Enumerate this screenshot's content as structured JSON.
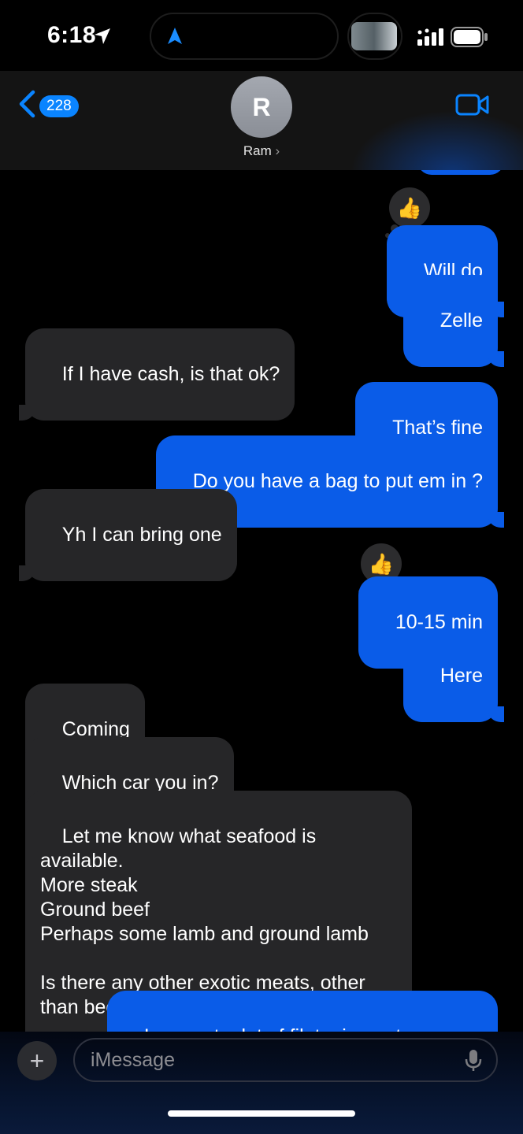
{
  "status_bar": {
    "time": "6:18",
    "icons": [
      "location-arrow-icon",
      "navigation-arrow-icon",
      "signal-icon",
      "battery-icon"
    ]
  },
  "header": {
    "back_count": "228",
    "avatar_initial": "R",
    "contact_name": "Ram",
    "contact_chevron": "›",
    "icons": [
      "chevron-left-icon",
      "video-call-icon"
    ]
  },
  "messages": [
    {
      "from": "me",
      "text": "Will do",
      "reaction": "👍"
    },
    {
      "from": "me",
      "text": "Zelle"
    },
    {
      "from": "them",
      "text": "If I have cash, is that ok?"
    },
    {
      "from": "me",
      "text": "That’s fine"
    },
    {
      "from": "me",
      "text": "Do you have a bag to put em in ?"
    },
    {
      "from": "them",
      "text": "Yh I can bring one"
    },
    {
      "from": "me",
      "text": "10-15 min",
      "reaction": "👍"
    },
    {
      "from": "me",
      "text": "Here"
    },
    {
      "from": "them",
      "text": "Coming"
    },
    {
      "from": "them",
      "text": "Which car you in?"
    },
    {
      "from": "them",
      "text": "Let me know what seafood is available.\nMore steak\nGround beef\nPerhaps some lamb and ground lamb\n\nIs there any other exotic meats, other than beef/chicken/turkey/lamb?"
    },
    {
      "from": "me",
      "text": "I can get a lot of filet mignon tomorrow"
    }
  ],
  "input": {
    "placeholder": "iMessage",
    "plus_label": "+",
    "icons": [
      "plus-icon",
      "microphone-icon"
    ]
  },
  "colors": {
    "outgoing_bubble": "#0a5ce8",
    "incoming_bubble": "#262628",
    "accent": "#0a84ff"
  }
}
